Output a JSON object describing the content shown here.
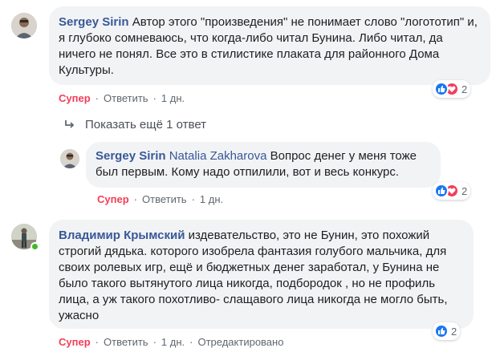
{
  "comments": [
    {
      "author": "Sergey Sirin",
      "mention": "",
      "text": "Автор этого \"произведения\" не понимает слово \"логототип\" и, я глубоко сомневаюсь, что когда-либо читал Бунина. Либо читал, да ничего не понял. Все это в стилистике плаката для районного Дома Культуры.",
      "actions": {
        "like": "Супер",
        "reply": "Ответить",
        "time": "1 дн.",
        "edited": ""
      },
      "reactions": {
        "types": [
          "like",
          "love"
        ],
        "count": "2"
      }
    },
    {
      "author": "Sergey Sirin",
      "mention": "Natalia Zakharova",
      "text": "Вопрос денег у меня тоже был первым. Кому надо отпилили, вот и весь конкурс.",
      "actions": {
        "like": "Супер",
        "reply": "Ответить",
        "time": "1 дн.",
        "edited": ""
      },
      "reactions": {
        "types": [
          "like",
          "love"
        ],
        "count": "2"
      }
    },
    {
      "author": "Владимир Крымский",
      "mention": "",
      "text": "издевательство, это не Бунин, это похожий строгий дядька. которого изобрела фантазия голубого мальчика, для своих ролевых игр, ещё и бюджетных денег заработал, у Бунина не было такого вытянутого лица никогда, подбородок , но не профиль лица, а уж такого похотливо- слащавого лица никогда не могло быть, ужасно",
      "actions": {
        "like": "Супер",
        "reply": "Ответить",
        "time": "1 дн.",
        "edited": "Отредактировано"
      },
      "reactions": {
        "types": [
          "like"
        ],
        "count": "2"
      }
    }
  ],
  "more_replies": {
    "icon": "reply-arrow-icon",
    "label": "Показать ещё 1 ответ"
  },
  "colors": {
    "author": "#385898",
    "like_active": "#f33e58",
    "bubble_bg": "#f2f3f5",
    "online": "#42b72a"
  }
}
